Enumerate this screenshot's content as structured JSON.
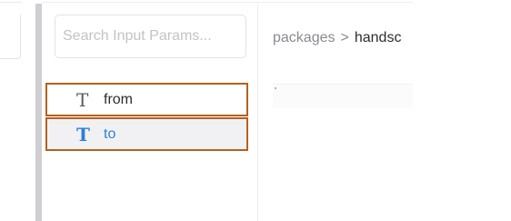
{
  "params_panel": {
    "search_placeholder": "Search Input Params...",
    "items": [
      {
        "type_icon": "T",
        "label": "from",
        "state": "default"
      },
      {
        "type_icon": "T",
        "label": "to",
        "state": "selected"
      }
    ]
  },
  "content": {
    "breadcrumb": {
      "root": "packages",
      "separator": ">",
      "current": "handsc"
    }
  },
  "colors": {
    "highlight_border": "#b4611c",
    "selected_accent": "#2f7fd6",
    "panel_divider": "#cfcfd3",
    "selected_background": "#f1f1f3"
  },
  "icons": {
    "param_type": "text-type-icon"
  }
}
